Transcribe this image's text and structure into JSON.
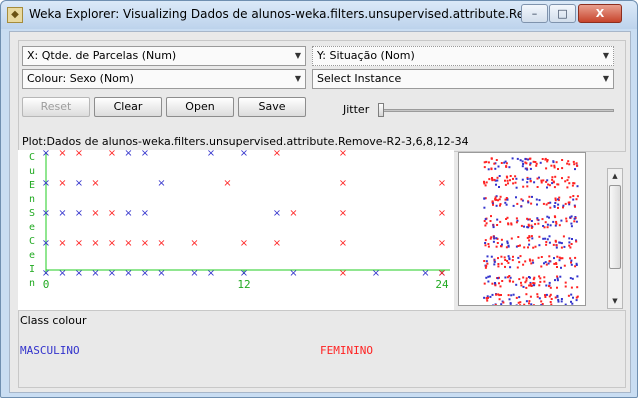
{
  "window": {
    "title": "Weka Explorer: Visualizing Dados de alunos-weka.filters.unsupervised.attribute.Rem…",
    "minimize": "–",
    "maximize": "□",
    "close": "X"
  },
  "controls": {
    "x_axis": "X: Qtde. de Parcelas (Num)",
    "y_axis": "Y: Situação (Nom)",
    "colour": "Colour: Sexo (Nom)",
    "instance": "Select Instance",
    "reset": "Reset",
    "clear": "Clear",
    "open": "Open",
    "save": "Save",
    "jitter": "Jitter"
  },
  "plot": {
    "title": "Plot:Dados de alunos-weka.filters.unsupervised.attribute.Remove-R2-3,6,8,12-34",
    "y_label_letters": [
      "C",
      "u",
      "E",
      "n",
      "S",
      "e",
      "C",
      "e",
      "I",
      "n"
    ],
    "x_ticks": [
      "0",
      "12",
      "24"
    ]
  },
  "mini_label": "X",
  "class_colour": {
    "title": "Class colour",
    "items": [
      {
        "label": "MASCULINO",
        "color": "#3333cc"
      },
      {
        "label": "FEMININO",
        "color": "#ff2222"
      }
    ]
  },
  "chart_data": {
    "type": "scatter",
    "xlim": [
      0,
      24
    ],
    "x_ticks": [
      0,
      12,
      24
    ],
    "categories": [
      "C",
      "E",
      "S",
      "C",
      "I"
    ],
    "series": [
      {
        "name": "MASCULINO",
        "color": "#3333cc",
        "marker": "x",
        "points": [
          [
            0,
            "C"
          ],
          [
            5,
            "C"
          ],
          [
            6,
            "C"
          ],
          [
            10,
            "C"
          ],
          [
            12,
            "C"
          ],
          [
            0,
            "E"
          ],
          [
            2,
            "E"
          ],
          [
            7,
            "E"
          ],
          [
            0,
            "S"
          ],
          [
            1,
            "S"
          ],
          [
            2,
            "S"
          ],
          [
            5,
            "S"
          ],
          [
            6,
            "S"
          ],
          [
            14,
            "S"
          ],
          [
            0,
            "C"
          ],
          [
            0,
            "I"
          ],
          [
            1,
            "I"
          ],
          [
            2,
            "I"
          ],
          [
            3,
            "I"
          ],
          [
            4,
            "I"
          ],
          [
            5,
            "I"
          ],
          [
            6,
            "I"
          ],
          [
            7,
            "I"
          ],
          [
            9,
            "I"
          ],
          [
            10,
            "I"
          ],
          [
            12,
            "I"
          ],
          [
            15,
            "I"
          ],
          [
            20,
            "I"
          ],
          [
            23,
            "I"
          ],
          [
            24,
            "I"
          ]
        ]
      },
      {
        "name": "FEMININO",
        "color": "#ff2222",
        "marker": "x",
        "points": [
          [
            1,
            "C"
          ],
          [
            2,
            "C"
          ],
          [
            4,
            "C"
          ],
          [
            14,
            "C"
          ],
          [
            18,
            "C"
          ],
          [
            1,
            "E"
          ],
          [
            3,
            "E"
          ],
          [
            11,
            "E"
          ],
          [
            18,
            "E"
          ],
          [
            24,
            "E"
          ],
          [
            3,
            "S"
          ],
          [
            4,
            "S"
          ],
          [
            15,
            "S"
          ],
          [
            18,
            "S"
          ],
          [
            24,
            "S"
          ],
          [
            1,
            "C"
          ],
          [
            2,
            "C"
          ],
          [
            3,
            "C"
          ],
          [
            4,
            "C"
          ],
          [
            5,
            "C"
          ],
          [
            6,
            "C"
          ],
          [
            7,
            "C"
          ],
          [
            9,
            "C"
          ],
          [
            12,
            "C"
          ],
          [
            14,
            "C"
          ],
          [
            18,
            "C"
          ],
          [
            24,
            "C"
          ],
          [
            18,
            "I"
          ],
          [
            24,
            "I"
          ]
        ]
      }
    ]
  }
}
